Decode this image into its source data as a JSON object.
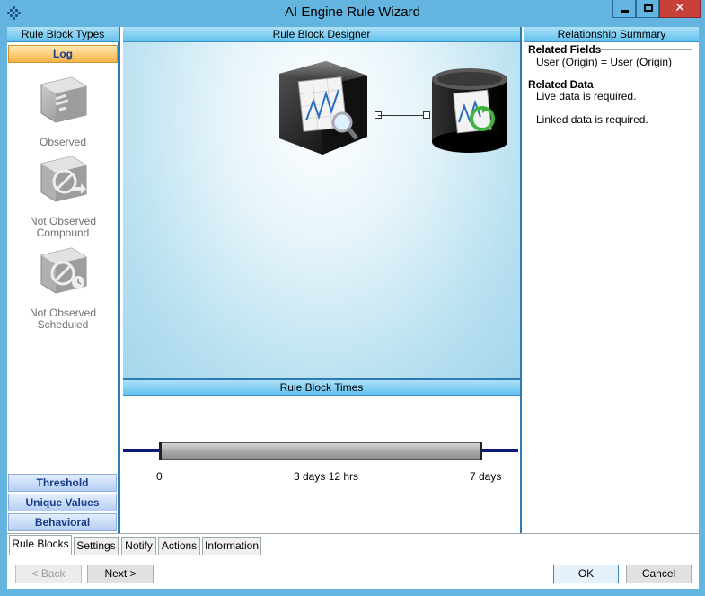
{
  "window": {
    "title": "AI Engine Rule Wizard",
    "controls": {
      "minimize": "minimize",
      "maximize": "maximize",
      "close": "✕"
    }
  },
  "left_panel": {
    "header": "Rule Block Types",
    "active_category": "Log",
    "blocks": [
      {
        "label_lines": [
          "Observed"
        ],
        "icon": "observed-block-icon"
      },
      {
        "label_lines": [
          "Not Observed",
          "Compound"
        ],
        "icon": "not-observed-compound-icon"
      },
      {
        "label_lines": [
          "Not Observed",
          "Scheduled"
        ],
        "icon": "not-observed-scheduled-icon"
      }
    ],
    "categories": [
      "Threshold",
      "Unique Values",
      "Behavioral"
    ]
  },
  "designer": {
    "header": "Rule Block Designer",
    "nodes": [
      "log-rule-block-icon",
      "linked-data-block-icon"
    ]
  },
  "times": {
    "header": "Rule Block Times",
    "labels": {
      "start": "0",
      "mid": "3 days 12 hrs",
      "end": "7 days"
    }
  },
  "summary": {
    "header": "Relationship Summary",
    "related_fields": {
      "title": "Related Fields",
      "lines": [
        "User (Origin) = User (Origin)"
      ]
    },
    "related_data": {
      "title": "Related Data",
      "lines": [
        "Live data is required.",
        "Linked data is required."
      ]
    }
  },
  "tabs": [
    "Rule Blocks",
    "Settings",
    "Notify",
    "Actions",
    "Information"
  ],
  "active_tab": "Rule Blocks",
  "buttons": {
    "back": "< Back",
    "next": "Next >",
    "ok": "OK",
    "cancel": "Cancel"
  },
  "colors": {
    "accent": "#2c7bb4",
    "header_blue": "#62c1ee",
    "active_category": "#f4b34a",
    "timeline": "#0b1a7a"
  }
}
